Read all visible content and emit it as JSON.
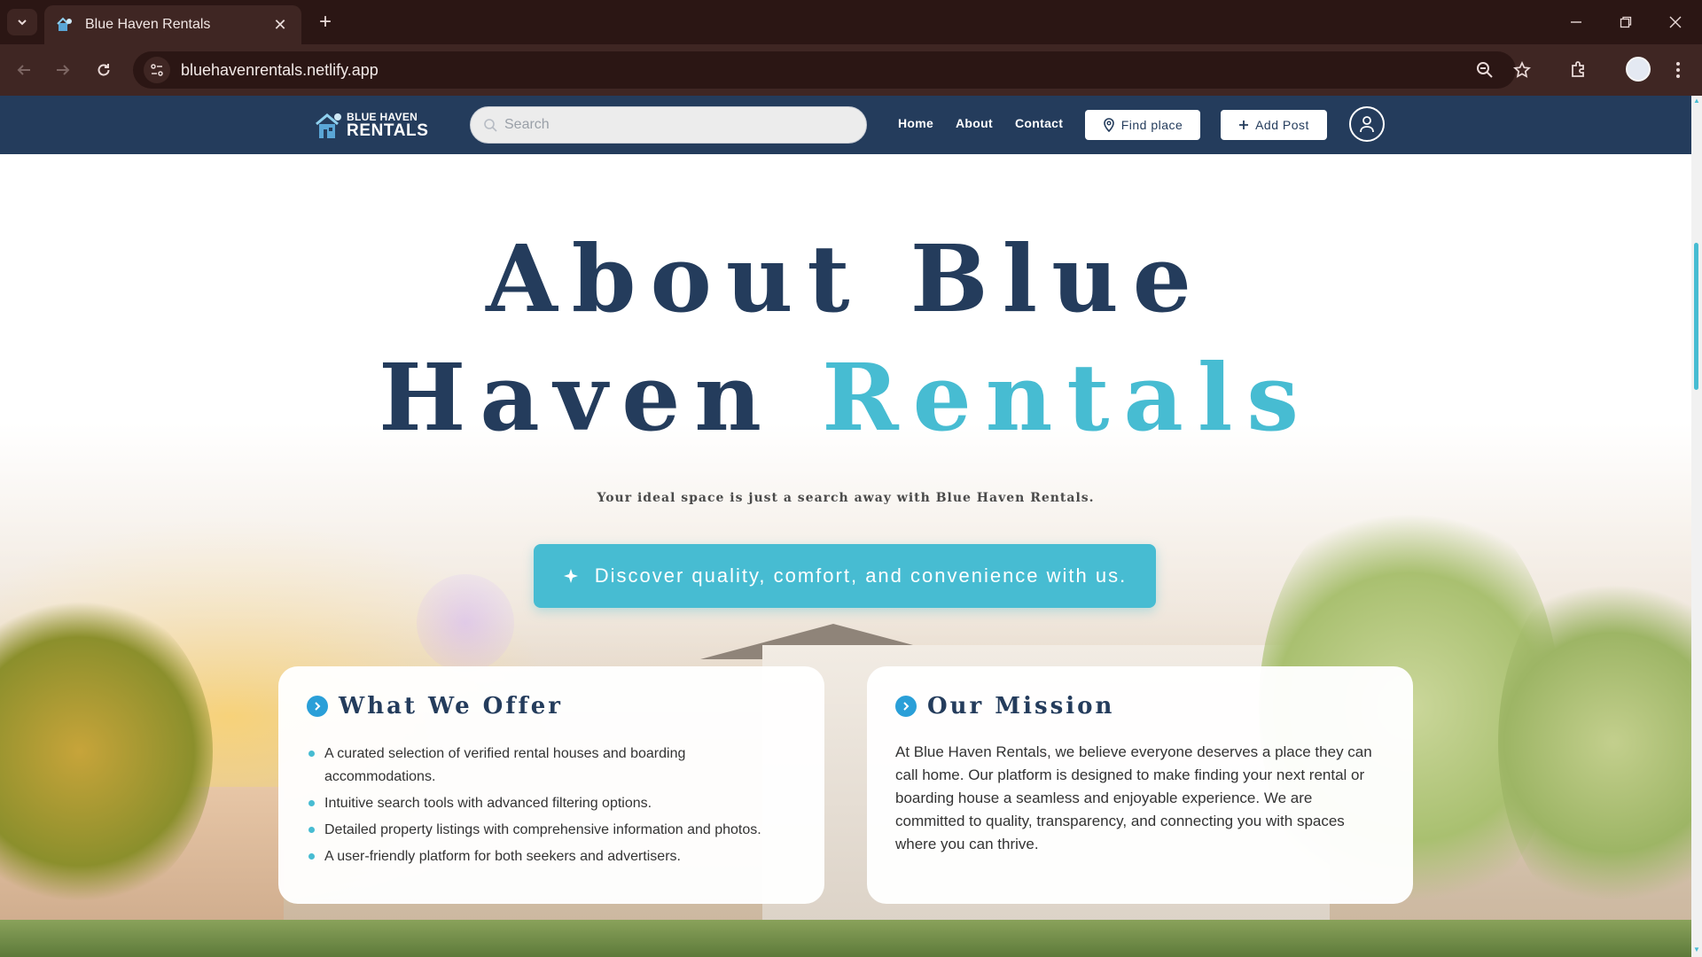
{
  "browser": {
    "tab_title": "Blue Haven Rentals",
    "url": "bluehavenrentals.netlify.app"
  },
  "site": {
    "logo_line1": "BLUE HAVEN",
    "logo_line2": "RENTALS",
    "search_placeholder": "Search",
    "nav": [
      "Home",
      "About",
      "Contact"
    ],
    "find_place": "Find place",
    "add_post": "Add Post"
  },
  "hero": {
    "title_line1": "About Blue",
    "title_line2_a": "Haven",
    "title_line2_b": "Rentals",
    "subtitle": "Your ideal space is just a search away with Blue Haven Rentals.",
    "cta": "Discover quality, comfort, and convenience with us."
  },
  "offer": {
    "heading": "What We Offer",
    "items": [
      "A curated selection of verified rental houses and boarding accommodations.",
      "Intuitive search tools with advanced filtering options.",
      "Detailed property listings with comprehensive information and photos.",
      "A user-friendly platform for both seekers and advertisers."
    ]
  },
  "mission": {
    "heading": "Our Mission",
    "body": "At Blue Haven Rentals, we believe everyone deserves a place they can call home. Our platform is designed to make finding your next rental or boarding house a seamless and enjoyable experience. We are committed to quality, transparency, and connecting you with spaces where you can thrive."
  },
  "colors": {
    "header": "#243c5c",
    "accent": "#47bcd2",
    "chrome": "#2b1614"
  }
}
